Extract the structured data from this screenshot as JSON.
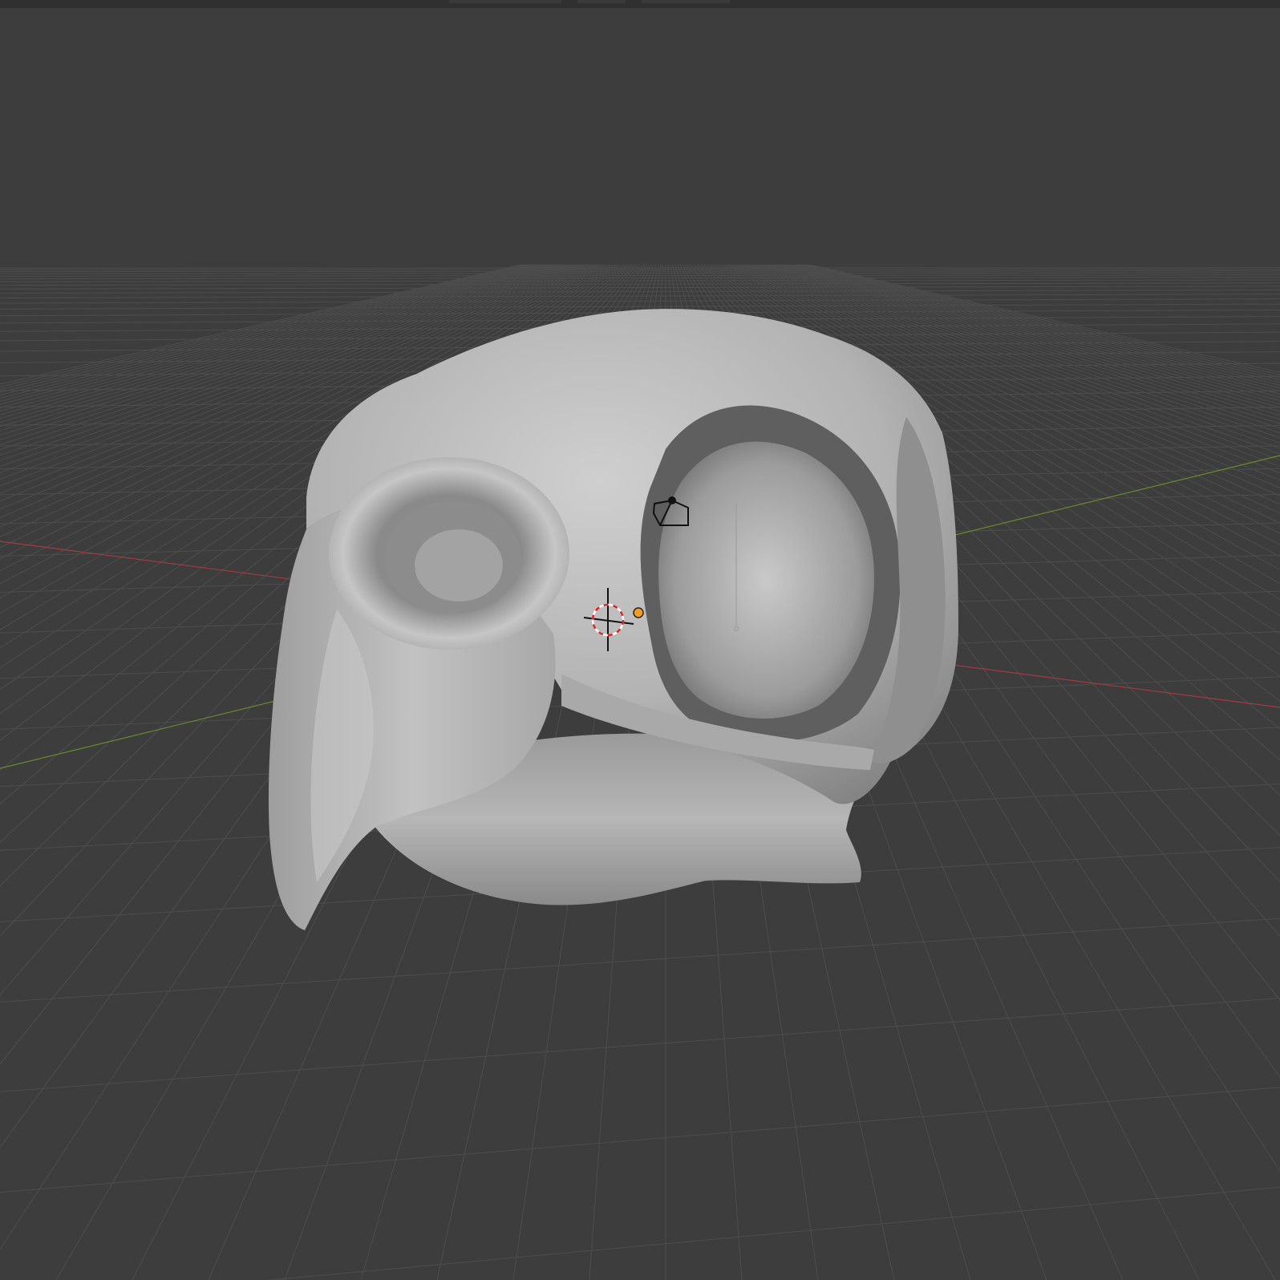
{
  "app": {
    "name": "",
    "view": "3D Viewport"
  },
  "scene": {
    "background_color": "#3d3d3d",
    "grid_color": "#4d4d4d",
    "x_axis_color": "#a33a42",
    "y_axis_color": "#6a8a2a",
    "mesh_base_color": "#b8b8b8",
    "mesh_shadow_color": "#6e6e6e",
    "origin_dot_color": "#f0a020",
    "objects": [
      {
        "name": "",
        "kind": "mesh",
        "icon": "skull-mesh-icon"
      },
      {
        "name": "",
        "kind": "camera",
        "icon": "camera-icon"
      },
      {
        "name": "",
        "kind": "3d-cursor",
        "icon": "crosshair-icon"
      },
      {
        "name": "",
        "kind": "object-origin",
        "icon": "origin-dot-icon"
      }
    ]
  }
}
